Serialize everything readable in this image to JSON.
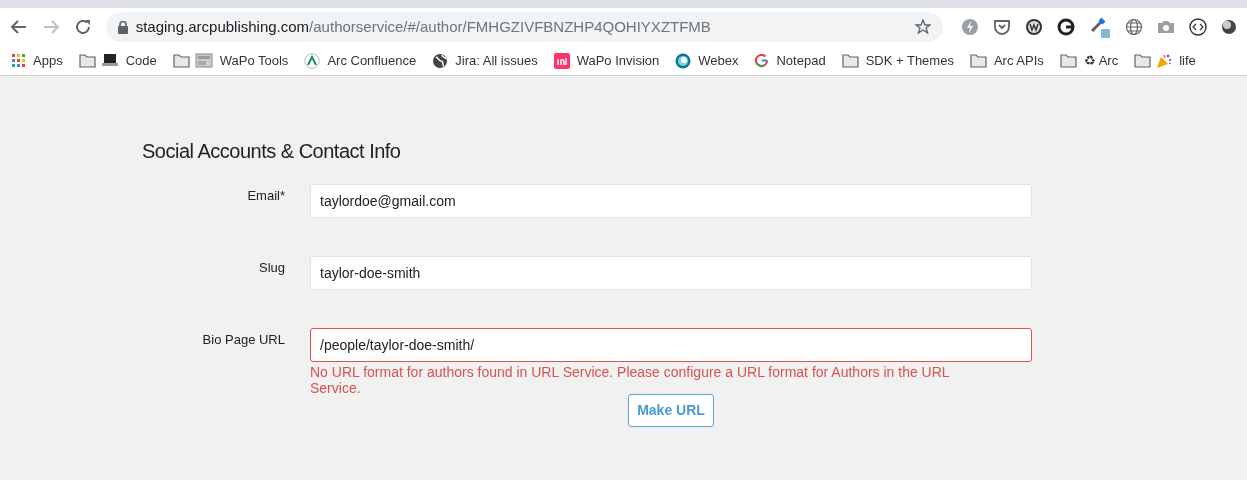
{
  "address_bar": {
    "host": "staging.arcpublishing.com",
    "path": "/authorservice/#/author/FMHGZIVFBNZHP4QOHIYXZTFMB"
  },
  "bookmarks": [
    {
      "label": "Apps",
      "kind": "apps"
    },
    {
      "label": "Code",
      "kind": "folder_laptop"
    },
    {
      "label": "WaPo Tools",
      "kind": "folder_thumb"
    },
    {
      "label": "Arc Confluence",
      "kind": "arc"
    },
    {
      "label": "Jira: All issues",
      "kind": "globe"
    },
    {
      "label": "WaPo Invision",
      "kind": "invision"
    },
    {
      "label": "Webex",
      "kind": "webex"
    },
    {
      "label": "Notepad",
      "kind": "google"
    },
    {
      "label": "SDK + Themes",
      "kind": "folder"
    },
    {
      "label": "Arc APIs",
      "kind": "folder"
    },
    {
      "label": "♻ Arc",
      "kind": "folder"
    },
    {
      "label": "life",
      "kind": "folder_party"
    }
  ],
  "section": {
    "title": "Social Accounts & Contact Info",
    "fields": [
      {
        "label": "Email*",
        "value": "taylordoe@gmail.com",
        "invalid": false
      },
      {
        "label": "Slug",
        "value": "taylor-doe-smith",
        "invalid": false
      },
      {
        "label": "Bio Page URL",
        "value": "/people/taylor-doe-smith/",
        "invalid": true,
        "error": "No URL format for authors found in URL Service. Please configure a URL format for Authors in the URL Service.",
        "button": "Make URL"
      }
    ]
  }
}
